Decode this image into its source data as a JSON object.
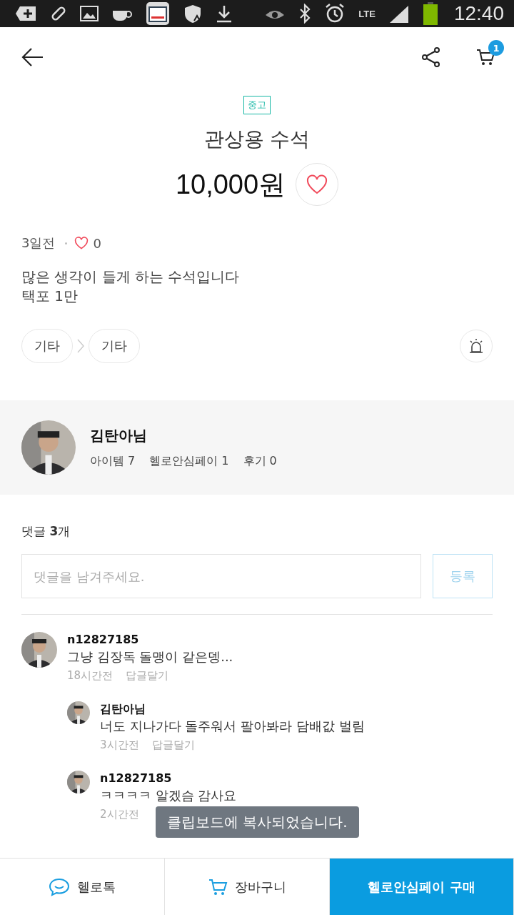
{
  "status_bar": {
    "network": "LTE",
    "time": "12:40"
  },
  "header": {
    "cart_count": "1"
  },
  "product": {
    "condition": "중고",
    "title": "관상용 수석",
    "price": "10,000원",
    "liked": false,
    "posted": "3일전",
    "likes": "0",
    "description": [
      "많은 생각이 들게 하는 수석입니다",
      "택포 1만"
    ],
    "categories": [
      "기타",
      "기타"
    ]
  },
  "seller": {
    "name": "김탄아님",
    "stats": [
      "아이템 7",
      "헬로안심페이 1",
      "후기 0"
    ]
  },
  "comments_section": {
    "heading": "댓글 **3**개",
    "placeholder": "댓글을 남겨주세요.",
    "submit": "등록",
    "comments": [
      {
        "author": "n12827185",
        "text": "그냥 김장독 돌맹이 같은뎅...",
        "time": "18시간전",
        "reply": "답글달기",
        "children": [
          {
            "author": "김탄아님",
            "text": "너도 지나가다 돌주워서 팔아봐라 담배값 벌림",
            "time": "3시간전",
            "reply": "답글달기"
          },
          {
            "author": "n12827185",
            "text": "ㅋㅋㅋㅋ 알겠슴 감사요",
            "time": "2시간전"
          }
        ]
      }
    ]
  },
  "toast": "클립보드에 복사되었습니다.",
  "bottom_bar": [
    {
      "kind": "chat",
      "label": "헬로톡"
    },
    {
      "kind": "cart",
      "label": "장바구니"
    },
    {
      "kind": "buy",
      "label": "헬로안심페이 구매"
    }
  ]
}
